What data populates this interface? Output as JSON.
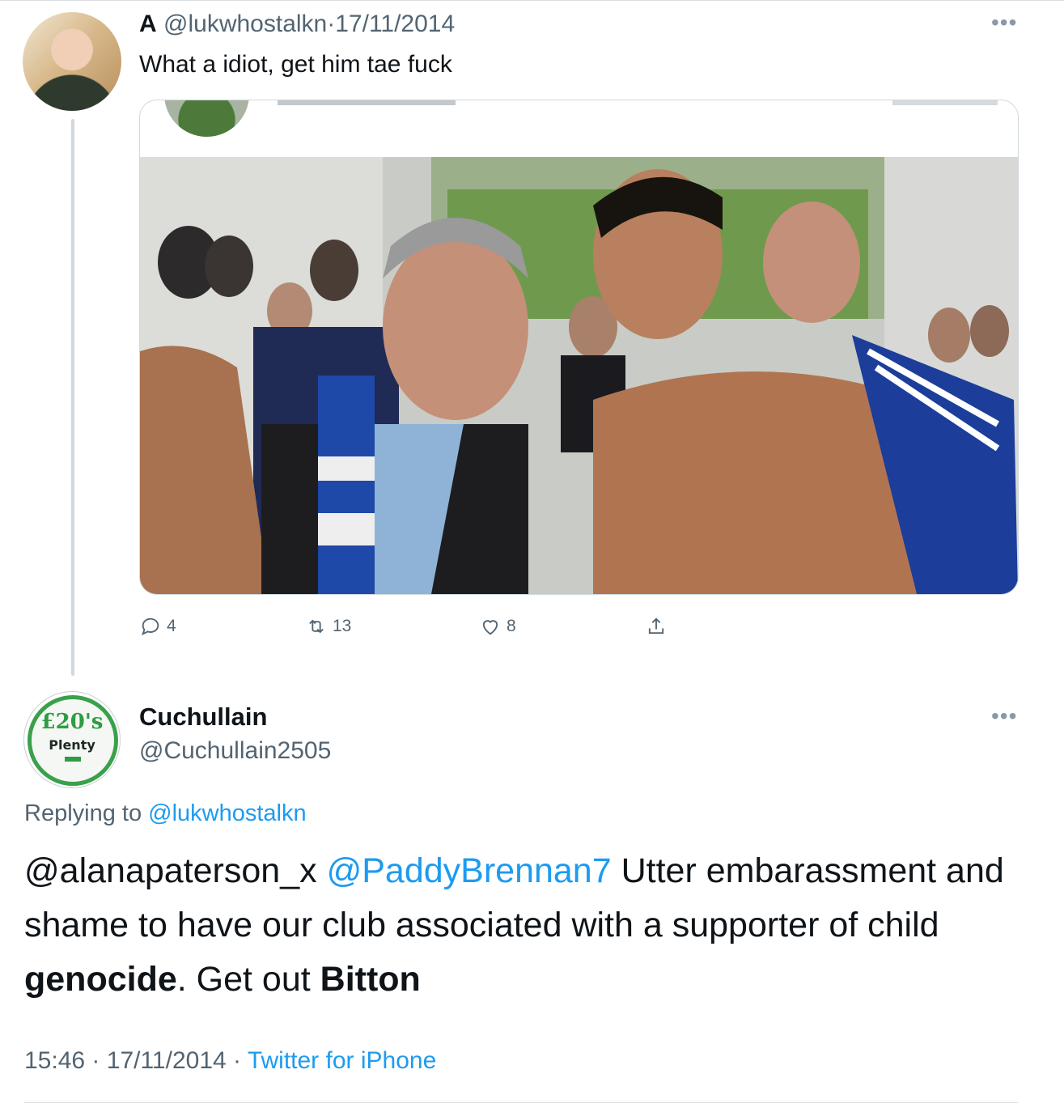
{
  "tweet1": {
    "display_name": "A",
    "handle": "@lukwhostalkn",
    "separator": "·",
    "date": "17/11/2014",
    "text": "What a idiot, get him tae fuck",
    "actions": {
      "replies": "4",
      "retweets": "13",
      "likes": "8"
    }
  },
  "tweet2": {
    "display_name": "Cuchullain",
    "handle": "@Cuchullain2505",
    "avatar_text_big": "£20's",
    "avatar_text_small": "Plenty",
    "replying_prefix": "Replying to",
    "replying_to": "@lukwhostalkn",
    "mention1": "@alanapaterson_x",
    "mention2": "@PaddyBrennan7",
    "body_part1": " Utter embarassment and shame to have our club associated with a supporter of child ",
    "body_bold1": "genocide",
    "body_part2": ". Get out ",
    "body_bold2": "Bitton",
    "time": "15:46",
    "date": "17/11/2014",
    "source": "Twitter for iPhone"
  },
  "icons": {
    "more": "more-horizontal-icon",
    "reply": "reply-icon",
    "retweet": "retweet-icon",
    "like": "heart-icon",
    "share": "share-icon"
  },
  "colors": {
    "link": "#1d9bf0",
    "muted": "#536471",
    "text": "#0f1419",
    "badge_green": "#3aa14a"
  }
}
